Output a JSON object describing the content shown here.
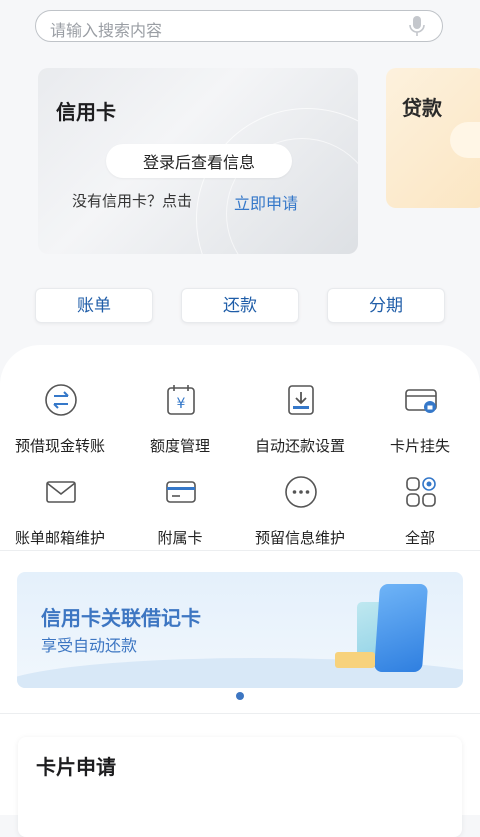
{
  "search": {
    "placeholder": "请输入搜索内容"
  },
  "cards": {
    "credit": {
      "title": "信用卡",
      "login_button": "登录后查看信息",
      "no_card_text": "没有信用卡？点击",
      "apply_link": "立即申请"
    },
    "loan": {
      "title": "贷款"
    }
  },
  "tabs": [
    {
      "label": "账单"
    },
    {
      "label": "还款"
    },
    {
      "label": "分期"
    }
  ],
  "services": [
    {
      "label": "预借现金转账",
      "icon": "transfer-icon"
    },
    {
      "label": "额度管理",
      "icon": "calendar-yuan-icon"
    },
    {
      "label": "自动还款设置",
      "icon": "download-tray-icon"
    },
    {
      "label": "卡片挂失",
      "icon": "card-lock-icon"
    },
    {
      "label": "账单邮箱维护",
      "icon": "mail-icon"
    },
    {
      "label": "附属卡",
      "icon": "card-icon"
    },
    {
      "label": "预留信息维护",
      "icon": "more-dots-icon"
    },
    {
      "label": "全部",
      "icon": "grid-all-icon"
    }
  ],
  "banner": {
    "title": "信用卡关联借记卡",
    "subtitle": "享受自动还款"
  },
  "section": {
    "title": "卡片申请"
  },
  "colors": {
    "accent": "#3578c9",
    "tab_text": "#1f5da8",
    "banner_text": "#3d76c2"
  }
}
